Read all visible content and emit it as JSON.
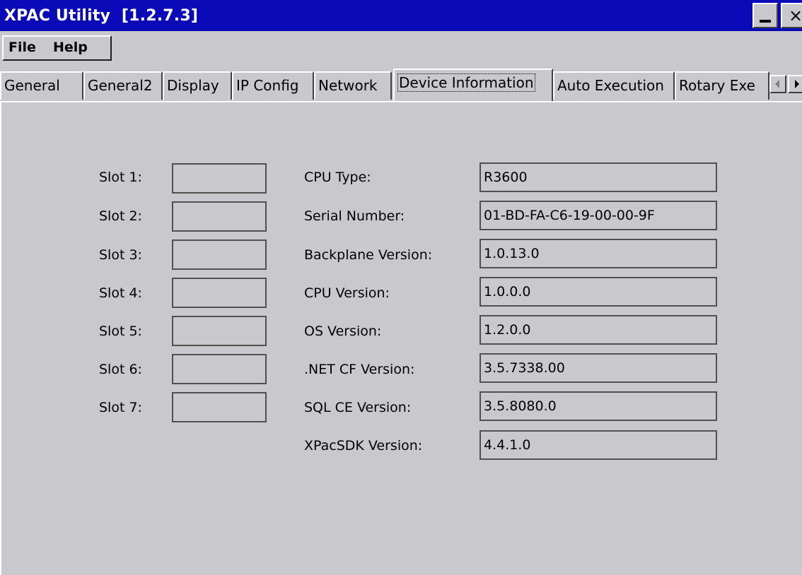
{
  "window": {
    "title": "XPAC Utility  [1.2.7.3]",
    "minimize_icon": "minimize-icon",
    "close_icon": "close-icon",
    "close_glyph": "×"
  },
  "menu": {
    "file_label": "File",
    "help_label": "Help"
  },
  "tabs": [
    {
      "label": "General"
    },
    {
      "label": "General2"
    },
    {
      "label": "Display"
    },
    {
      "label": "IP Config"
    },
    {
      "label": "Network"
    },
    {
      "label": "Device Information",
      "selected": true
    },
    {
      "label": "Auto Execution"
    },
    {
      "label": "Rotary Exe"
    }
  ],
  "slots": [
    {
      "label": "Slot 1:",
      "value": ""
    },
    {
      "label": "Slot 2:",
      "value": ""
    },
    {
      "label": "Slot 3:",
      "value": ""
    },
    {
      "label": "Slot 4:",
      "value": ""
    },
    {
      "label": "Slot 5:",
      "value": ""
    },
    {
      "label": "Slot 6:",
      "value": ""
    },
    {
      "label": "Slot 7:",
      "value": ""
    }
  ],
  "info": [
    {
      "label": "CPU  Type:",
      "value": "R3600"
    },
    {
      "label": "Serial Number:",
      "value": "01-BD-FA-C6-19-00-00-9F"
    },
    {
      "label": "Backplane Version:",
      "value": "1.0.13.0"
    },
    {
      "label": "CPU Version:",
      "value": "1.0.0.0"
    },
    {
      "label": "OS Version:",
      "value": "1.2.0.0"
    },
    {
      "label": ".NET CF Version:",
      "value": "3.5.7338.00"
    },
    {
      "label": "SQL CE Version:",
      "value": "3.5.8080.0"
    },
    {
      "label": "XPacSDK Version:",
      "value": "4.4.1.0"
    }
  ],
  "colors": {
    "titlebar": "#0a0ab9",
    "background": "#c9c8cd"
  }
}
